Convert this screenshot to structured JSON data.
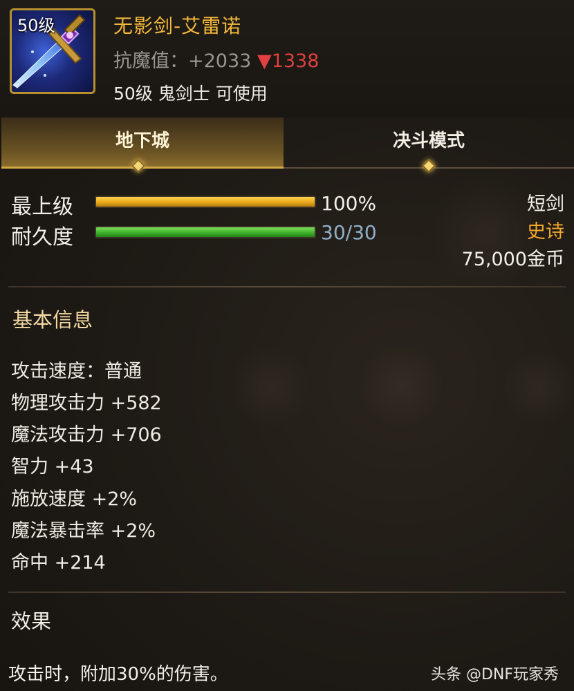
{
  "item": {
    "icon_level": "50级",
    "name": "无影剑-艾雷诺",
    "resist_label": "抗魔值：",
    "resist_value": "+2033",
    "resist_delta": "▼1338",
    "requirement": "50级 鬼剑士 可使用",
    "icon": "sword-icon"
  },
  "tabs": [
    {
      "label": "地下城",
      "active": true
    },
    {
      "label": "决斗模式",
      "active": false
    }
  ],
  "grade": {
    "label": "最上级",
    "value_text": "100%",
    "fill": 1.0
  },
  "durability": {
    "label": "耐久度",
    "value_text": "30/30",
    "fill": 1.0
  },
  "side_info": {
    "type": "短剑",
    "rarity": "史诗",
    "price": "75,000金币"
  },
  "basic_info": {
    "title": "基本信息",
    "attributes": [
      "攻击速度：普通",
      "物理攻击力 +582",
      "魔法攻击力 +706",
      "智力 +43",
      "施放速度 +2%",
      "魔法暴击率 +2%",
      "命中 +214"
    ]
  },
  "effect": {
    "title": "效果",
    "text": "攻击时，附加30%的伤害。"
  },
  "watermark": "头条 @DNF玩家秀",
  "colors": {
    "item_name": "#f4b93a",
    "rarity": "#f4a82c",
    "delta": "#e04040",
    "durability_text": "#8fb1c9"
  }
}
